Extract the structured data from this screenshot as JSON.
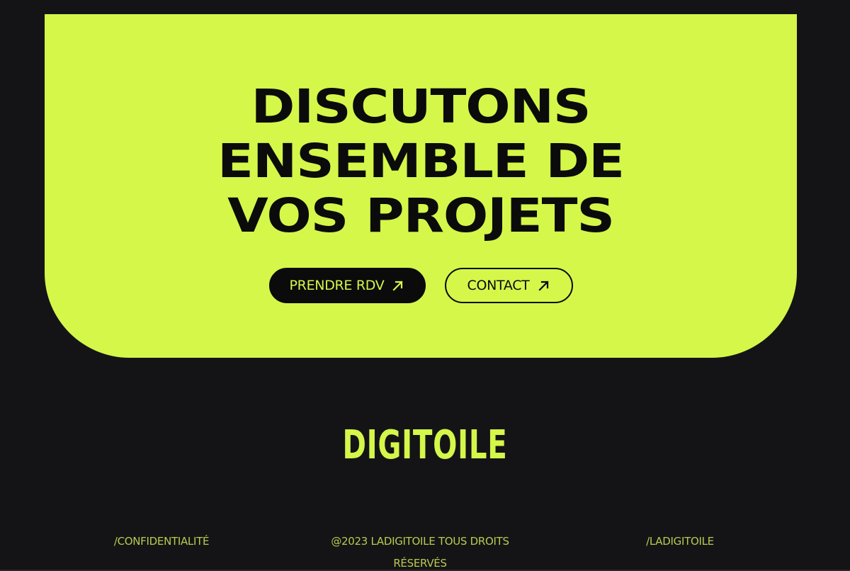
{
  "cta": {
    "heading_lines": [
      "DISCUTONS",
      "ENSEMBLE DE",
      "VOS PROJETS"
    ],
    "primary_button": {
      "label": "PRENDRE RDV",
      "icon": "arrow-up-right-icon"
    },
    "secondary_button": {
      "label": "CONTACT",
      "icon": "arrow-up-right-icon"
    }
  },
  "brand": {
    "logo_text": "DIGITOILE"
  },
  "footer": {
    "privacy_link": "/CONFIDENTIALITÉ",
    "copyright": "@2023 LADIGITOILE TOUS DROITS RÉSERVÉS",
    "social_link": "/LADIGITOILE"
  },
  "colors": {
    "accent": "#d4f74a",
    "background": "#141416",
    "text_dark": "#0b0b0b",
    "footer_text": "#b7cb50"
  }
}
